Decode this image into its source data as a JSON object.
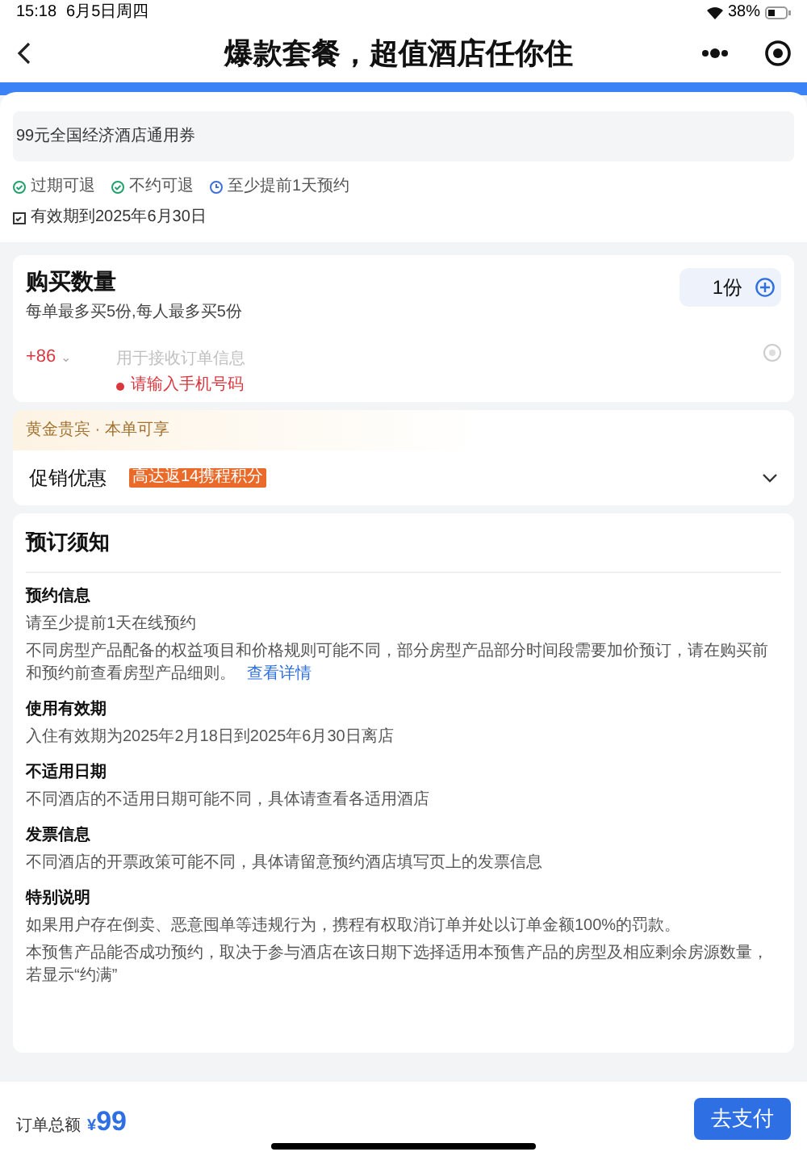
{
  "status_bar": {
    "time": "15:18",
    "date": "6月5日周四",
    "battery": "38%"
  },
  "nav": {
    "title": "爆款套餐，超值酒店任你住"
  },
  "product": {
    "name": "99元全国经济酒店通用券",
    "tags": [
      {
        "kind": "check",
        "label": "过期可退"
      },
      {
        "kind": "check",
        "label": "不约可退"
      },
      {
        "kind": "clock",
        "label": "至少提前1天预约"
      }
    ],
    "validity": "有效期到2025年6月30日"
  },
  "purchase": {
    "title": "购买数量",
    "limit": "每单最多买5份,每人最多买5份",
    "quantity": "1份",
    "country_code": "+86",
    "country_caret": "⌄",
    "phone_placeholder": "用于接收订单信息",
    "error": "请输入手机号码"
  },
  "member": {
    "label": "黄金贵宾 · 本单可享"
  },
  "promo": {
    "label": "促销优惠",
    "tag": "高达返14携程积分",
    "expanded": false
  },
  "notice": {
    "title": "预订须知",
    "sections": [
      {
        "heading": "预约信息",
        "paragraphs": [
          "请至少提前1天在线预约",
          "不同房型产品配备的权益项目和价格规则可能不同，部分房型产品部分时间段需要加价预订，请在购买前和预约前查看房型产品细则。"
        ],
        "link": "查看详情"
      },
      {
        "heading": "使用有效期",
        "paragraphs": [
          "入住有效期为2025年2月18日到2025年6月30日离店"
        ]
      },
      {
        "heading": "不适用日期",
        "paragraphs": [
          "不同酒店的不适用日期可能不同，具体请查看各适用酒店"
        ]
      },
      {
        "heading": "发票信息",
        "paragraphs": [
          "不同酒店的开票政策可能不同，具体请留意预约酒店填写页上的发票信息"
        ]
      },
      {
        "heading": "特别说明",
        "paragraphs": [
          "如果用户存在倒卖、恶意囤单等违规行为，携程有权取消订单并处以订单金额100%的罚款。",
          "本预售产品能否成功预约，取决于参与酒店在该日期下选择适用本预售产品的房型及相应剩余房源数量，若显示“约满”"
        ]
      }
    ]
  },
  "footer": {
    "total_label": "订单总额",
    "currency": "¥",
    "amount": "99",
    "pay_button": "去支付"
  }
}
